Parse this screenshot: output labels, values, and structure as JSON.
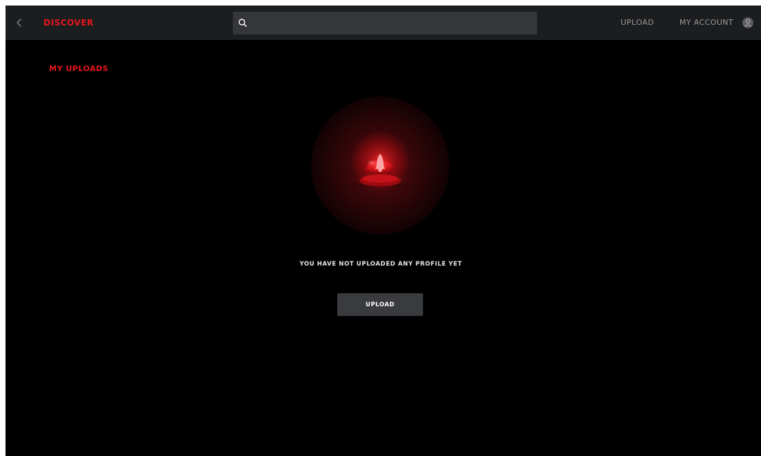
{
  "header": {
    "discover_label": "DISCOVER",
    "search_placeholder": "",
    "upload_label": "UPLOAD",
    "account_label": "MY ACCOUNT"
  },
  "main": {
    "title": "MY UPLOADS",
    "empty_message": "YOU HAVE NOT UPLOADED ANY PROFILE YET",
    "upload_button_label": "UPLOAD"
  },
  "icons": {
    "back": "chevron-left-icon",
    "search": "search-icon",
    "avatar": "user-avatar-icon",
    "illustration": "empty-uploads-illustration"
  },
  "colors": {
    "accent": "#e8161c",
    "topbar": "#1c1d1f",
    "background": "#000000",
    "search_bg": "#35363a",
    "button_bg": "#3a3b3f",
    "nav_text": "#9a9a9a"
  }
}
